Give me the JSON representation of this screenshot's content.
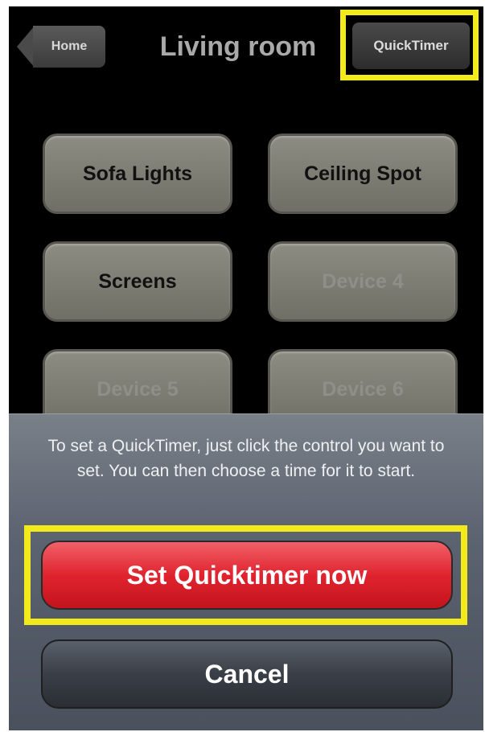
{
  "navbar": {
    "back_label": "Home",
    "title": "Living room",
    "quicktimer_label": "QuickTimer"
  },
  "devices": [
    {
      "label": "Sofa Lights",
      "enabled": true
    },
    {
      "label": "Ceiling Spot",
      "enabled": true
    },
    {
      "label": "Screens",
      "enabled": true
    },
    {
      "label": "Device 4",
      "enabled": false
    },
    {
      "label": "Device 5",
      "enabled": false
    },
    {
      "label": "Device 6",
      "enabled": false
    }
  ],
  "action_sheet": {
    "message": "To set a QuickTimer, just click the control you want to set. You can then choose a time for it to start.",
    "primary_label": "Set Quicktimer now",
    "cancel_label": "Cancel"
  },
  "colors": {
    "highlight": "#f2ea1a",
    "primary_button": "#e0242f"
  }
}
